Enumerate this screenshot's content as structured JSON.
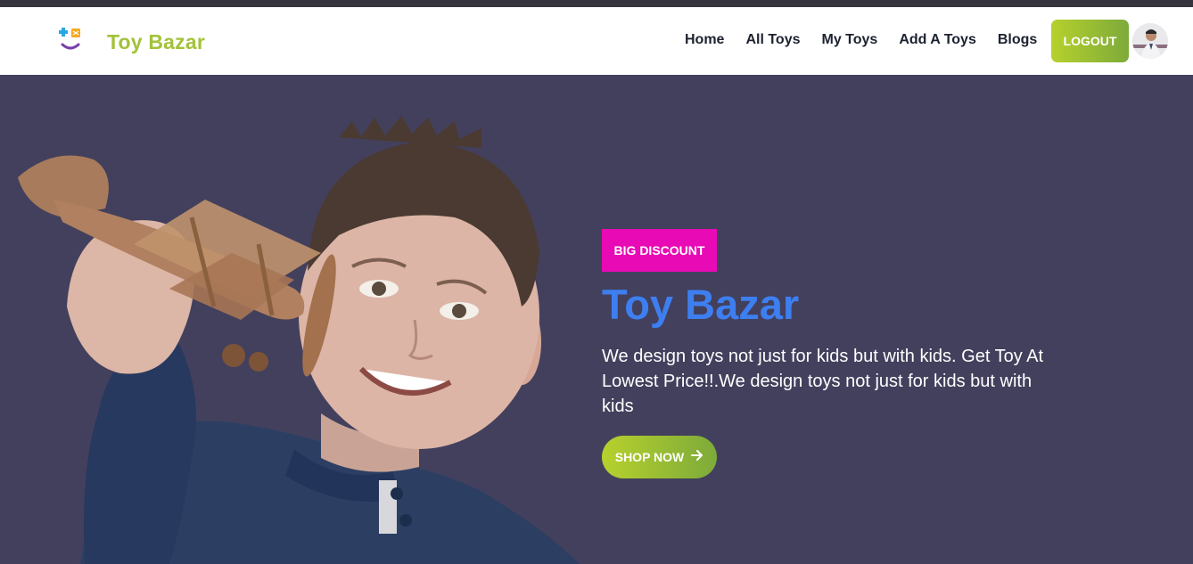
{
  "brand": {
    "name": "Toy Bazar",
    "logo_icon": "puzzle-smile-logo"
  },
  "nav": {
    "links": [
      "Home",
      "All Toys",
      "My Toys",
      "Add A Toys",
      "Blogs"
    ],
    "logout_label": "LOGOUT",
    "avatar_icon": "user-avatar"
  },
  "hero": {
    "badge": "BIG DISCOUNT",
    "title": "Toy Bazar",
    "description": "We design toys not just for kids but with kids. Get Toy At Lowest Price!!.We design toys not just for kids but with kids",
    "cta_label": "SHOP NOW",
    "cta_icon": "arrow-right-icon",
    "image_icon": "boy-with-toy-airplane"
  },
  "colors": {
    "accent_green": "#a3c23a",
    "badge_pink": "#e80ab4",
    "title_blue": "#3d7ff0",
    "hero_bg": "#43405d"
  }
}
